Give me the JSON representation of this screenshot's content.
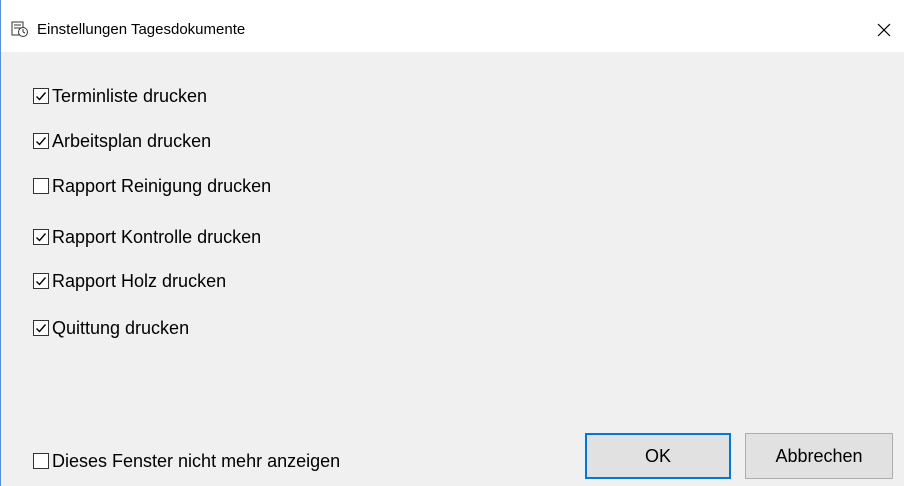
{
  "window": {
    "title": "Einstellungen Tagesdokumente",
    "app_icon": "app-icon",
    "close_icon": "close-icon"
  },
  "options": [
    {
      "label": "Terminliste drucken",
      "checked": true
    },
    {
      "label": "Arbeitsplan drucken",
      "checked": true
    },
    {
      "label": "Rapport Reinigung drucken",
      "checked": false
    },
    {
      "label": "Rapport Kontrolle drucken",
      "checked": true
    },
    {
      "label": "Rapport Holz drucken",
      "checked": true
    },
    {
      "label": "Quittung drucken",
      "checked": true
    }
  ],
  "footer": {
    "dont_show_label": "Dieses Fenster nicht mehr anzeigen",
    "dont_show_checked": false,
    "ok_label": "OK",
    "cancel_label": "Abbrechen"
  },
  "colors": {
    "accent": "#0078d7",
    "background": "#f0f0f0"
  }
}
